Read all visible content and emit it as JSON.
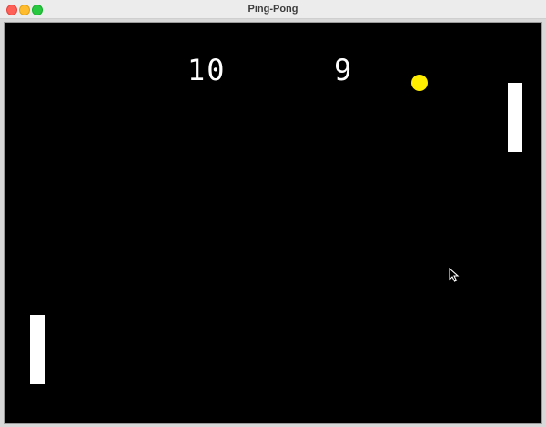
{
  "window": {
    "title": "Ping-Pong"
  },
  "scoreboard": {
    "left_score": "10",
    "right_score": "9"
  },
  "colors": {
    "background": "#000000",
    "paddle": "#ffffff",
    "ball": "#ffee00",
    "score_text": "#ffffff"
  },
  "icons": {
    "cursor": "arrow-cursor-icon"
  }
}
